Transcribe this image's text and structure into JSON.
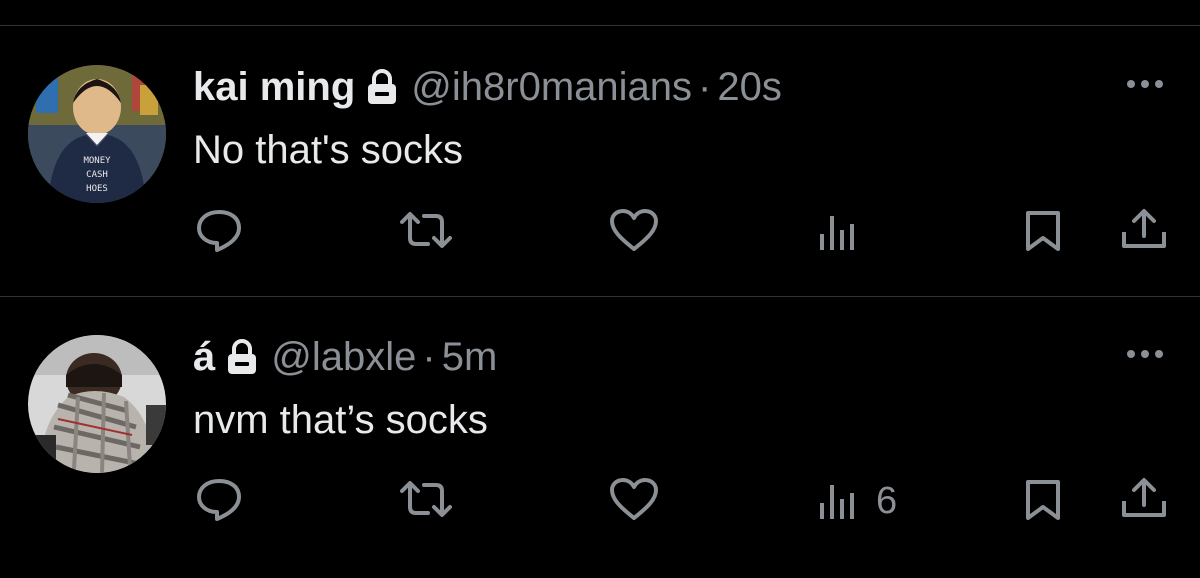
{
  "tweets": [
    {
      "name": "kai ming",
      "handle": "@ih8r0manians",
      "separator": "·",
      "time": "20s",
      "text": "No that's socks",
      "views": "",
      "avatar_text": [
        "MONEY",
        "CASH",
        "HOES"
      ]
    },
    {
      "name": "á",
      "handle": "@labxle",
      "separator": "·",
      "time": "5m",
      "text": "nvm that’s socks",
      "views": "6",
      "avatar_text": []
    }
  ],
  "colors": {
    "background": "#000000",
    "primary_text": "#e7e9ea",
    "secondary_text": "#8b9096",
    "divider": "#2f3336"
  },
  "icons": [
    "lock-icon",
    "more-icon",
    "reply-icon",
    "retweet-icon",
    "like-icon",
    "views-icon",
    "bookmark-icon",
    "share-icon"
  ]
}
